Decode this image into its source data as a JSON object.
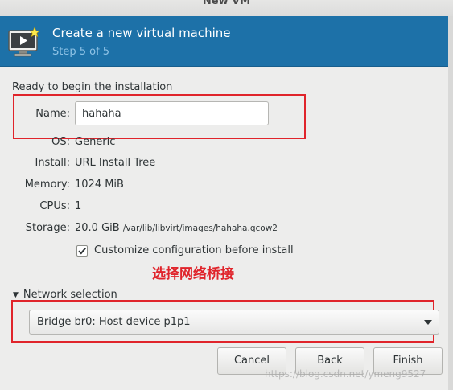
{
  "window": {
    "title": "New VM"
  },
  "header": {
    "title": "Create a new virtual machine",
    "step": "Step 5 of 5",
    "icon": "virtual-machine-monitor-icon"
  },
  "summary": {
    "section_title": "Ready to begin the installation",
    "name_label": "Name:",
    "name_value": "hahaha",
    "os_label": "OS:",
    "os_value": "Generic",
    "install_label": "Install:",
    "install_value": "URL Install Tree",
    "memory_label": "Memory:",
    "memory_value": "1024 MiB",
    "cpus_label": "CPUs:",
    "cpus_value": "1",
    "storage_label": "Storage:",
    "storage_size": "20.0 GiB",
    "storage_path": "/var/lib/libvirt/images/hahaha.qcow2",
    "customize_label": "Customize configuration before install",
    "customize_checked": true
  },
  "annotation": {
    "text": "选择网络桥接",
    "color": "#e0242b"
  },
  "network": {
    "expander_label": "Network selection",
    "selected": "Bridge br0: Host device p1p1"
  },
  "buttons": {
    "cancel": "Cancel",
    "back": "Back",
    "finish": "Finish"
  },
  "watermark": {
    "text": "https://blog.csdn.net/ymeng9527"
  },
  "colors": {
    "header_bg": "#1d71a8",
    "header_step": "#8fc3e6",
    "highlight_red": "#e0242b"
  }
}
